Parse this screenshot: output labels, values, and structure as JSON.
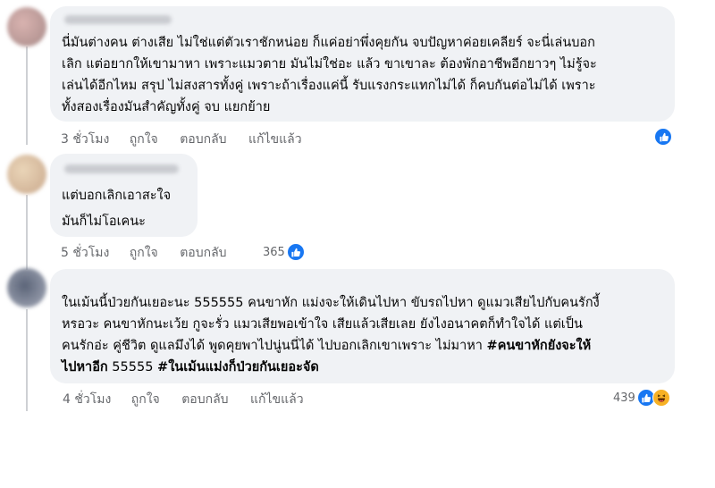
{
  "comments": [
    {
      "lines": [
        "นี่มันต่างคน ต่างเสีย ไม่ใช่แต่ตัวเราชักหน่อย ก็แค่อย่าพึ่งคุยกัน จบปัญหาค่อยเคลียร์ จะนี่เล่นบอก",
        "เลิก แต่อยากให้เขามาหา เพราะแมวตาย มันไม่ใช่อะ แล้ว ขาเขาละ ต้องพักอาชีพอีกยาวๆ ไม่รู้จะ",
        "เล่นได้อีกไหม สรุป ไม่สงสารทั้งคู่ เพราะถ้าเรื่องแค่นี้ รับแรงกระแทกไม่ได้ ก็คบกันต่อไม่ได้ เพราะ",
        "ทั้งสองเรื่องมันสำคัญทั้งคู่ จบ แยกย้าย"
      ],
      "time": "3 ชั่วโมง",
      "like": "ถูกใจ",
      "reply": "ตอบกลับ",
      "edited": "แก้ไขแล้ว",
      "reaction_count": ""
    },
    {
      "lines": [
        "แต่บอกเลิกเอาสะใจ",
        "มันก็ไม่โอเคนะ"
      ],
      "time": "5 ชั่วโมง",
      "like": "ถูกใจ",
      "reply": "ตอบกลับ",
      "reaction_count": "365"
    },
    {
      "lines": [
        "ในเม้นนี้ป่วยกันเยอะนะ 555555 คนขาหัก แม่งจะให้เดินไปหา ขับรถไปหา ดูแมวเสียไปกับคนรักงี้",
        "หรอวะ คนขาหักนะเว้ย กูจะรั่ว แมวเสียพอเข้าใจ เสียแล้วเสียเลย ยังไงอนาคตก็ทำใจได้ แต่เป็น",
        "คนรักอ่ะ คู่ชีวิต ดูแลมึงได้ พูดคุยพาไปนู่นนี่ได้ ไปบอกเลิกเขาเพราะ ไม่มาหา "
      ],
      "tag1": "#คนขาหักยังจะให้",
      "line4_tag": "ไปหาอีก",
      "line4_mid": " 55555 ",
      "tag2": "#ในเม้นแม่งก็ป่วยกันเยอะจัด",
      "time": "4 ชั่วโมง",
      "like": "ถูกใจ",
      "reply": "ตอบกลับ",
      "edited": "แก้ไขแล้ว",
      "reaction_count": "439"
    }
  ],
  "colors": {
    "like_blue": "#1877f2",
    "bubble": "#f0f2f5",
    "meta": "#65676b"
  }
}
